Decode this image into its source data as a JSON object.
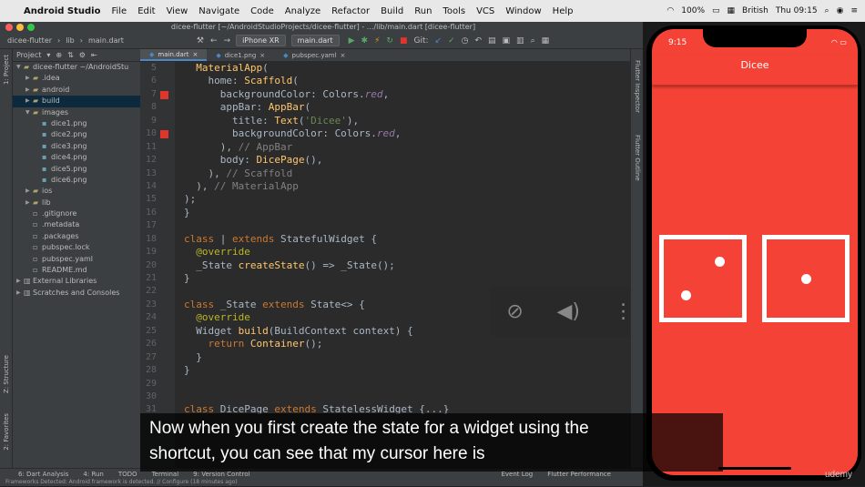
{
  "menubar": {
    "app_name": "Android Studio",
    "items": [
      "File",
      "Edit",
      "View",
      "Navigate",
      "Code",
      "Analyze",
      "Refactor",
      "Build",
      "Run",
      "Tools",
      "VCS",
      "Window",
      "Help"
    ],
    "battery": "100%",
    "locale": "British",
    "clock": "Thu 09:15"
  },
  "titlebar": {
    "text": "dicee-flutter [~/AndroidStudioProjects/dicee-flutter] - .../lib/main.dart [dicee-flutter]"
  },
  "toolbar": {
    "crumbs": [
      "dicee-flutter",
      "lib",
      "main.dart"
    ],
    "device": "iPhone XR",
    "run_config": "main.dart",
    "git_label": "Git:"
  },
  "sidebar": {
    "project_label": "1: Project",
    "structure_label": "Z: Structure",
    "favorites_label": "2: Favorites"
  },
  "project": {
    "header": "Project",
    "tree": [
      {
        "label": "dicee-flutter ~/AndroidStu",
        "indent": 0,
        "arrow": "▼",
        "icon": "folder"
      },
      {
        "label": ".idea",
        "indent": 1,
        "arrow": "▶",
        "icon": "folder"
      },
      {
        "label": "android",
        "indent": 1,
        "arrow": "▶",
        "icon": "folder"
      },
      {
        "label": "build",
        "indent": 1,
        "arrow": "▶",
        "icon": "folder"
      },
      {
        "label": "images",
        "indent": 1,
        "arrow": "▼",
        "icon": "folder"
      },
      {
        "label": "dice1.png",
        "indent": 2,
        "arrow": "",
        "icon": "image"
      },
      {
        "label": "dice2.png",
        "indent": 2,
        "arrow": "",
        "icon": "image"
      },
      {
        "label": "dice3.png",
        "indent": 2,
        "arrow": "",
        "icon": "image"
      },
      {
        "label": "dice4.png",
        "indent": 2,
        "arrow": "",
        "icon": "image"
      },
      {
        "label": "dice5.png",
        "indent": 2,
        "arrow": "",
        "icon": "image"
      },
      {
        "label": "dice6.png",
        "indent": 2,
        "arrow": "",
        "icon": "image"
      },
      {
        "label": "ios",
        "indent": 1,
        "arrow": "▶",
        "icon": "folder"
      },
      {
        "label": "lib",
        "indent": 1,
        "arrow": "▶",
        "icon": "folder"
      },
      {
        "label": ".gitignore",
        "indent": 1,
        "arrow": "",
        "icon": "file"
      },
      {
        "label": ".metadata",
        "indent": 1,
        "arrow": "",
        "icon": "file"
      },
      {
        "label": ".packages",
        "indent": 1,
        "arrow": "",
        "icon": "file"
      },
      {
        "label": "pubspec.lock",
        "indent": 1,
        "arrow": "",
        "icon": "file"
      },
      {
        "label": "pubspec.yaml",
        "indent": 1,
        "arrow": "",
        "icon": "file"
      },
      {
        "label": "README.md",
        "indent": 1,
        "arrow": "",
        "icon": "file"
      },
      {
        "label": "External Libraries",
        "indent": 0,
        "arrow": "▶",
        "icon": "lib"
      },
      {
        "label": "Scratches and Consoles",
        "indent": 0,
        "arrow": "▶",
        "icon": "lib"
      }
    ]
  },
  "editor": {
    "tabs": [
      {
        "label": "main.dart",
        "active": true
      },
      {
        "label": "dice1.png",
        "active": false
      },
      {
        "label": "pubspec.yaml",
        "active": false
      }
    ],
    "lines": [
      {
        "n": "5",
        "bp": false,
        "html": "  <span class=\"fn\">MaterialApp</span>("
      },
      {
        "n": "6",
        "bp": false,
        "html": "    home: <span class=\"fn\">Scaffold</span>("
      },
      {
        "n": "7",
        "bp": true,
        "html": "      backgroundColor: Colors.<span class=\"it\">red</span>,"
      },
      {
        "n": "8",
        "bp": false,
        "html": "      appBar: <span class=\"fn\">AppBar</span>("
      },
      {
        "n": "9",
        "bp": false,
        "html": "        title: <span class=\"fn\">Text</span>(<span class=\"str\">'Dicee'</span>),"
      },
      {
        "n": "10",
        "bp": true,
        "html": "        backgroundColor: Colors.<span class=\"it\">red</span>,"
      },
      {
        "n": "11",
        "bp": false,
        "html": "      ), <span class=\"cm\">// AppBar</span>"
      },
      {
        "n": "12",
        "bp": false,
        "html": "      body: <span class=\"fn\">DicePage</span>(),"
      },
      {
        "n": "13",
        "bp": false,
        "html": "    ), <span class=\"cm\">// Scaffold</span>"
      },
      {
        "n": "14",
        "bp": false,
        "html": "  ), <span class=\"cm\">// MaterialApp</span>"
      },
      {
        "n": "15",
        "bp": false,
        "html": ");"
      },
      {
        "n": "16",
        "bp": false,
        "html": "}"
      },
      {
        "n": "17",
        "bp": false,
        "html": ""
      },
      {
        "n": "18",
        "bp": false,
        "html": "<span class=\"kw\">class</span> | <span class=\"kw\">extends</span> StatefulWidget {"
      },
      {
        "n": "19",
        "bp": false,
        "html": "  <span class=\"ann\">@override</span>"
      },
      {
        "n": "20",
        "bp": false,
        "html": "  _State <span class=\"fn\">createState</span>() =&gt; _State();"
      },
      {
        "n": "21",
        "bp": false,
        "html": "}"
      },
      {
        "n": "22",
        "bp": false,
        "html": ""
      },
      {
        "n": "23",
        "bp": false,
        "html": "<span class=\"kw\">class</span> _State <span class=\"kw\">extends</span> State&lt;&gt; {"
      },
      {
        "n": "24",
        "bp": false,
        "html": "  <span class=\"ann\">@override</span>"
      },
      {
        "n": "25",
        "bp": false,
        "html": "  Widget <span class=\"fn\">build</span>(BuildContext context) {"
      },
      {
        "n": "26",
        "bp": false,
        "html": "    <span class=\"kw\">return</span> <span class=\"fn\">Container</span>();"
      },
      {
        "n": "27",
        "bp": false,
        "html": "  }"
      },
      {
        "n": "28",
        "bp": false,
        "html": "}"
      },
      {
        "n": "29",
        "bp": false,
        "html": ""
      },
      {
        "n": "30",
        "bp": false,
        "html": ""
      },
      {
        "n": "31",
        "bp": false,
        "html": "<span class=\"kw\">class</span> DicePage <span class=\"kw\">extends</span> StatelessWidget {...}"
      }
    ]
  },
  "right_strip": {
    "inspector_label": "Flutter Inspector",
    "outline_label": "Flutter Outline"
  },
  "caption": {
    "line1": "Now when you first create the state for a widget using the",
    "line2": "shortcut, you can see that my cursor here is"
  },
  "statusbar": {
    "tools": [
      "6: Dart Analysis",
      "4: Run",
      "TODO",
      "Terminal",
      "9: Version Control",
      "Event Log",
      "Flutter Performance"
    ],
    "message": "Frameworks Detected: Android framework is detected. // Configure (18 minutes ago)"
  },
  "simulator": {
    "time": "9:15",
    "app_title": "Dicee",
    "dice": [
      {
        "pips": [
          [
            0.72,
            0.28
          ],
          [
            0.28,
            0.72
          ]
        ]
      },
      {
        "pips": [
          [
            0.5,
            0.5
          ]
        ]
      }
    ]
  },
  "watermark": "udemy",
  "colors": {
    "accent_red": "#f44336",
    "editor_bg": "#2b2b2b",
    "panel_bg": "#3c3f41"
  }
}
